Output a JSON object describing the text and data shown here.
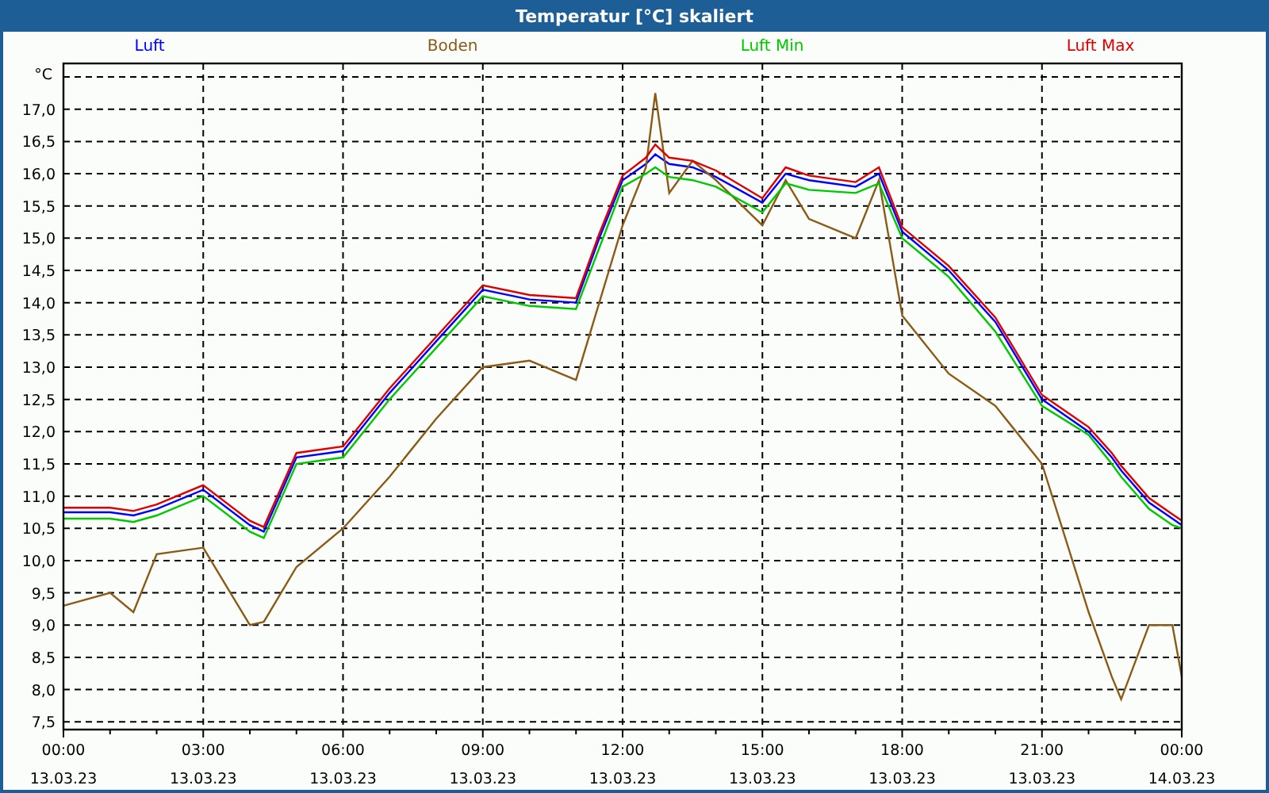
{
  "window": {
    "title": "Temperatur [°C] skaliert"
  },
  "chart": {
    "chart_data": {
      "type": "line",
      "ylabel": "°C",
      "x": [
        0,
        1,
        1.5,
        2,
        3,
        4,
        4.3,
        5,
        6,
        7,
        8,
        9,
        10,
        11,
        11.5,
        12,
        12.5,
        12.7,
        13,
        13.5,
        14,
        15,
        15.5,
        16,
        17,
        17.5,
        18,
        19,
        20,
        21,
        22,
        22.5,
        22.7,
        23.3,
        23.8,
        24
      ],
      "series": [
        {
          "name": "Luft",
          "color": "#0000ff",
          "values": [
            10.75,
            10.75,
            10.7,
            10.8,
            11.1,
            10.55,
            10.45,
            11.6,
            11.7,
            12.6,
            13.4,
            14.2,
            14.05,
            14.0,
            15.0,
            15.9,
            16.15,
            16.3,
            16.15,
            16.1,
            15.95,
            15.55,
            16.0,
            15.9,
            15.8,
            16.0,
            15.1,
            14.5,
            13.7,
            12.5,
            12.0,
            11.6,
            11.4,
            10.9,
            10.65,
            10.55
          ]
        },
        {
          "name": "Boden",
          "color": "#8b5a14",
          "values": [
            9.3,
            9.5,
            9.2,
            10.1,
            10.2,
            9.0,
            9.05,
            9.9,
            10.5,
            11.3,
            12.2,
            13.0,
            13.1,
            12.8,
            14.0,
            15.2,
            16.1,
            17.25,
            15.7,
            16.2,
            15.9,
            15.2,
            15.9,
            15.3,
            15.0,
            15.9,
            13.8,
            12.9,
            12.4,
            11.5,
            9.2,
            8.2,
            7.85,
            9.0,
            9.0,
            8.2
          ]
        },
        {
          "name": "Luft Min",
          "color": "#00c800",
          "values": [
            10.65,
            10.65,
            10.6,
            10.7,
            11.0,
            10.45,
            10.35,
            11.5,
            11.6,
            12.5,
            13.3,
            14.1,
            13.95,
            13.9,
            14.85,
            15.8,
            16.0,
            16.1,
            15.95,
            15.9,
            15.8,
            15.4,
            15.85,
            15.75,
            15.7,
            15.85,
            15.0,
            14.4,
            13.55,
            12.4,
            11.95,
            11.5,
            11.3,
            10.8,
            10.55,
            10.5
          ]
        },
        {
          "name": "Luft Max",
          "color": "#e00000",
          "values": [
            10.82,
            10.82,
            10.77,
            10.87,
            11.17,
            10.62,
            10.52,
            11.67,
            11.77,
            12.67,
            13.47,
            14.27,
            14.12,
            14.07,
            15.07,
            15.97,
            16.25,
            16.45,
            16.25,
            16.2,
            16.05,
            15.62,
            16.1,
            15.97,
            15.87,
            16.1,
            15.17,
            14.57,
            13.77,
            12.57,
            12.07,
            11.67,
            11.47,
            10.97,
            10.72,
            10.62
          ]
        }
      ],
      "xlim": [
        0,
        24
      ],
      "ylim": [
        7.38,
        17.71
      ],
      "xticks": [
        {
          "value": 0,
          "label": "00:00"
        },
        {
          "value": 3,
          "label": "03:00"
        },
        {
          "value": 6,
          "label": "06:00"
        },
        {
          "value": 9,
          "label": "09:00"
        },
        {
          "value": 12,
          "label": "12:00"
        },
        {
          "value": 15,
          "label": "15:00"
        },
        {
          "value": 18,
          "label": "18:00"
        },
        {
          "value": 21,
          "label": "21:00"
        },
        {
          "value": 24,
          "label": "00:00"
        }
      ],
      "grid": true,
      "yticks": [
        {
          "value": 7.5,
          "label": "7,5"
        },
        {
          "value": 8,
          "label": "8,0"
        },
        {
          "value": 8.5,
          "label": "8,5"
        },
        {
          "value": 9,
          "label": "9,0"
        },
        {
          "value": 9.5,
          "label": "9,5"
        },
        {
          "value": 10,
          "label": "10,0"
        },
        {
          "value": 10.5,
          "label": "10,5"
        },
        {
          "value": 11,
          "label": "11,0"
        },
        {
          "value": 11.5,
          "label": "11,5"
        },
        {
          "value": 12,
          "label": "12,0"
        },
        {
          "value": 12.5,
          "label": "12,5"
        },
        {
          "value": 13,
          "label": "13,0"
        },
        {
          "value": 13.5,
          "label": "13,5"
        },
        {
          "value": 14,
          "label": "14,0"
        },
        {
          "value": 14.5,
          "label": "14,5"
        },
        {
          "value": 15,
          "label": "15,0"
        },
        {
          "value": 15.5,
          "label": "15,5"
        },
        {
          "value": 16,
          "label": "16,0"
        },
        {
          "value": 16.5,
          "label": "16,5"
        },
        {
          "value": 17,
          "label": "17,0"
        }
      ]
    },
    "x_axis_dates": [
      "13.03.23",
      "13.03.23",
      "13.03.23",
      "13.03.23",
      "13.03.23",
      "13.03.23",
      "13.03.23",
      "13.03.23",
      "14.03.23"
    ]
  }
}
